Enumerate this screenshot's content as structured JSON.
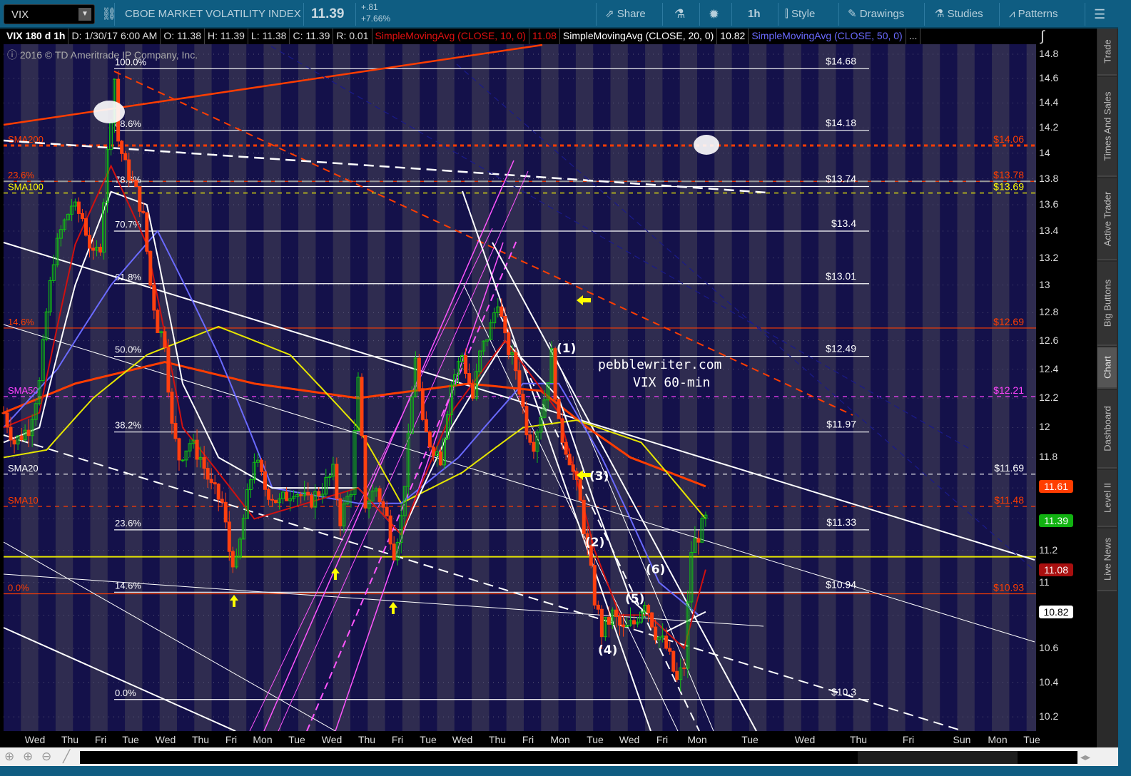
{
  "toolbar": {
    "symbol": "VIX",
    "description": "CBOE MARKET VOLATILITY INDEX",
    "last": "11.39",
    "change": "+.81",
    "change_pct": "+7.66%",
    "share": "Share",
    "timeframe": "1h",
    "style": "Style",
    "drawings": "Drawings",
    "studies": "Studies",
    "patterns": "Patterns"
  },
  "info": {
    "title": "VIX 180 d 1h",
    "date": "D: 1/30/17 6:00 AM",
    "open": "O: 11.38",
    "high": "H: 11.39",
    "low": "L: 11.38",
    "close": "C: 11.39",
    "range": "R: 0.01",
    "sma10": "SimpleMovingAvg (CLOSE, 10, 0)",
    "sma10_val": "11.08",
    "sma20": "SimpleMovingAvg (CLOSE, 20, 0)",
    "sma20_val": "10.82",
    "sma50": "SimpleMovingAvg (CLOSE, 50, 0)",
    "more": "..."
  },
  "copyright": "2016 © TD Ameritrade IP Company, Inc.",
  "watermark": "pebblewriter.com",
  "subtitle": "VIX 60-min",
  "sidebar": [
    "Trade",
    "Times And Sales",
    "Active Trader",
    "Big Buttons",
    "Chart",
    "Dashboard",
    "Level II",
    "Live News"
  ],
  "badges": [
    {
      "value": "11.61",
      "color": "#ff3d00"
    },
    {
      "value": "11.39",
      "color": "#11b211"
    },
    {
      "value": "11.08",
      "color": "#a80f0f"
    },
    {
      "value": "10.82",
      "color": "#ffffff"
    }
  ],
  "chart_data": {
    "type": "candlestick",
    "symbol": "VIX",
    "period": "180 d",
    "interval": "1h",
    "yticks": [
      14.8,
      14.6,
      14.4,
      14.2,
      14,
      13.8,
      13.6,
      13.4,
      13.2,
      13,
      12.8,
      12.6,
      12.4,
      12.2,
      12,
      11.8,
      11.6,
      11.4,
      11.2,
      11,
      10.8,
      10.6,
      10.4,
      10.2
    ],
    "ylim": [
      10.2,
      14.8
    ],
    "xticks": [
      "Wed",
      "Thu",
      "Fri",
      "Tue",
      "Wed",
      "Thu",
      "Fri",
      "Mon",
      "Tue",
      "Wed",
      "Thu",
      "Fri",
      "Tue",
      "Wed",
      "Thu",
      "Fri",
      "Mon",
      "Tue",
      "Wed",
      "Fri",
      "Mon",
      "Tue",
      "Wed",
      "Thu",
      "Fri",
      "Sun",
      "Mon",
      "Tue"
    ],
    "fib_levels": [
      {
        "pct": "100.0%",
        "price": 14.68,
        "label": "$14.68"
      },
      {
        "pct": "88.6%",
        "price": 14.18,
        "label": "$14.18"
      },
      {
        "pct": "78.6%",
        "price": 13.74,
        "label": "$13.74"
      },
      {
        "pct": "70.7%",
        "price": 13.4,
        "label": "$13.4"
      },
      {
        "pct": "61.8%",
        "price": 13.01,
        "label": "$13.01"
      },
      {
        "pct": "50.0%",
        "price": 12.49,
        "label": "$12.49"
      },
      {
        "pct": "38.2%",
        "price": 11.97,
        "label": "$11.97"
      },
      {
        "pct": "23.6%",
        "price": 11.33,
        "label": "$11.33"
      },
      {
        "pct": "14.6%",
        "price": 10.94,
        "label": "$10.94"
      },
      {
        "pct": "0.0%",
        "price": 10.3,
        "label": "$10.3"
      }
    ],
    "levels": [
      {
        "name": "SMA200",
        "price": 14.06,
        "label": "$14.06",
        "color": "#ff3d00",
        "style": "dotted"
      },
      {
        "name": "23.6%",
        "price": 13.78,
        "label": "$13.78",
        "color": "#ff3d00",
        "style": "solid"
      },
      {
        "name": "SMA100",
        "price": 13.69,
        "label": "$13.69",
        "color": "#ffff00",
        "style": "dashed"
      },
      {
        "name": "14.6%",
        "price": 12.69,
        "label": "$12.69",
        "color": "#ff3d00",
        "style": "solid"
      },
      {
        "name": "SMA50",
        "price": 12.21,
        "label": "$12.21",
        "color": "#ff44ff",
        "style": "dashed"
      },
      {
        "name": "SMA20",
        "price": 11.69,
        "label": "$11.69",
        "color": "#ffffff",
        "style": "dashed"
      },
      {
        "name": "SMA10",
        "price": 11.48,
        "label": "$11.48",
        "color": "#ff3d00",
        "style": "dashed"
      },
      {
        "name": "0.0%",
        "price": 10.93,
        "label": "$10.93",
        "color": "#ff3d00",
        "style": "solid"
      }
    ],
    "waves": [
      "(1)",
      "(2)",
      "(3)",
      "(4)",
      "(5)",
      "(6)"
    ],
    "close_path": [
      [
        0,
        12.1
      ],
      [
        3,
        11.9
      ],
      [
        7,
        12.0
      ],
      [
        10,
        12.3
      ],
      [
        12,
        12.8
      ],
      [
        14,
        13.2
      ],
      [
        16,
        13.4
      ],
      [
        19,
        13.6
      ],
      [
        22,
        13.5
      ],
      [
        25,
        13.2
      ],
      [
        27,
        13.3
      ],
      [
        29,
        14.0
      ],
      [
        31,
        14.6
      ],
      [
        32,
        14.1
      ],
      [
        34,
        13.9
      ],
      [
        37,
        13.7
      ],
      [
        39,
        13.5
      ],
      [
        41,
        13.0
      ],
      [
        43,
        12.7
      ],
      [
        45,
        12.6
      ],
      [
        47,
        12.0
      ],
      [
        49,
        11.8
      ],
      [
        52,
        11.9
      ],
      [
        55,
        11.8
      ],
      [
        58,
        11.6
      ],
      [
        61,
        11.5
      ],
      [
        63,
        11.2
      ],
      [
        65,
        11.1
      ],
      [
        67,
        11.4
      ],
      [
        70,
        11.8
      ],
      [
        73,
        11.6
      ],
      [
        77,
        11.5
      ],
      [
        81,
        11.6
      ],
      [
        85,
        11.5
      ],
      [
        89,
        11.6
      ],
      [
        92,
        11.7
      ],
      [
        94,
        11.4
      ],
      [
        97,
        11.6
      ],
      [
        99,
        12.3
      ],
      [
        101,
        11.5
      ],
      [
        104,
        11.6
      ],
      [
        107,
        11.4
      ],
      [
        109,
        11.2
      ],
      [
        111,
        11.4
      ],
      [
        113,
        11.9
      ],
      [
        115,
        12.5
      ],
      [
        117,
        12.0
      ],
      [
        119,
        11.9
      ],
      [
        122,
        11.8
      ],
      [
        125,
        12.3
      ],
      [
        128,
        12.5
      ],
      [
        131,
        12.2
      ],
      [
        133,
        12.5
      ],
      [
        136,
        12.7
      ],
      [
        138,
        12.9
      ],
      [
        140,
        12.6
      ],
      [
        143,
        12.4
      ],
      [
        146,
        12.0
      ],
      [
        148,
        11.9
      ],
      [
        151,
        12.2
      ],
      [
        153,
        12.5
      ],
      [
        155,
        12.0
      ],
      [
        158,
        11.8
      ],
      [
        161,
        11.5
      ],
      [
        163,
        11.2
      ],
      [
        165,
        10.9
      ],
      [
        167,
        10.7
      ],
      [
        170,
        10.8
      ],
      [
        173,
        10.7
      ],
      [
        176,
        10.75
      ],
      [
        179,
        10.9
      ],
      [
        182,
        10.7
      ],
      [
        185,
        10.6
      ],
      [
        188,
        10.4
      ],
      [
        190,
        10.5
      ],
      [
        192,
        11.2
      ],
      [
        194,
        11.3
      ],
      [
        196,
        11.39
      ]
    ],
    "series": [
      {
        "name": "SMA 200h",
        "color": "#ff3d00",
        "points": [
          [
            0,
            12.1
          ],
          [
            20,
            12.3
          ],
          [
            45,
            12.45
          ],
          [
            70,
            12.3
          ],
          [
            99,
            12.2
          ],
          [
            130,
            12.3
          ],
          [
            150,
            12.25
          ],
          [
            163,
            12.0
          ],
          [
            175,
            11.8
          ],
          [
            196,
            11.61
          ]
        ]
      },
      {
        "name": "SMA 100h",
        "color": "#e6e600",
        "points": [
          [
            0,
            11.8
          ],
          [
            12,
            11.85
          ],
          [
            25,
            12.2
          ],
          [
            40,
            12.5
          ],
          [
            60,
            12.7
          ],
          [
            80,
            12.5
          ],
          [
            99,
            12.0
          ],
          [
            111,
            11.5
          ],
          [
            128,
            11.7
          ],
          [
            145,
            12.0
          ],
          [
            160,
            12.05
          ],
          [
            178,
            11.9
          ],
          [
            196,
            11.4
          ]
        ]
      },
      {
        "name": "SMA 50",
        "color": "#6a6aff",
        "points": [
          [
            0,
            12.0
          ],
          [
            15,
            12.4
          ],
          [
            30,
            13.0
          ],
          [
            43,
            13.4
          ],
          [
            60,
            12.5
          ],
          [
            75,
            11.6
          ],
          [
            99,
            11.5
          ],
          [
            111,
            11.5
          ],
          [
            127,
            11.8
          ],
          [
            145,
            12.3
          ],
          [
            155,
            12.3
          ],
          [
            167,
            11.8
          ],
          [
            183,
            11.0
          ],
          [
            194,
            10.8
          ]
        ]
      },
      {
        "name": "SMA 20",
        "color": "#ffffff",
        "points": [
          [
            0,
            11.9
          ],
          [
            10,
            12.0
          ],
          [
            20,
            13.0
          ],
          [
            30,
            13.7
          ],
          [
            40,
            13.6
          ],
          [
            50,
            12.3
          ],
          [
            60,
            11.8
          ],
          [
            75,
            11.6
          ],
          [
            99,
            11.6
          ],
          [
            111,
            11.3
          ],
          [
            125,
            12.0
          ],
          [
            140,
            12.6
          ],
          [
            155,
            12.2
          ],
          [
            165,
            11.5
          ],
          [
            175,
            10.9
          ],
          [
            185,
            10.7
          ],
          [
            196,
            10.82
          ]
        ]
      },
      {
        "name": "SMA 10",
        "color": "#d01010",
        "points": [
          [
            0,
            12.0
          ],
          [
            10,
            12.1
          ],
          [
            20,
            13.3
          ],
          [
            30,
            13.9
          ],
          [
            40,
            13.3
          ],
          [
            50,
            12.0
          ],
          [
            60,
            11.7
          ],
          [
            70,
            11.4
          ],
          [
            99,
            11.6
          ],
          [
            111,
            11.3
          ],
          [
            125,
            12.1
          ],
          [
            140,
            12.6
          ],
          [
            155,
            12.1
          ],
          [
            165,
            11.2
          ],
          [
            172,
            10.8
          ],
          [
            180,
            10.8
          ],
          [
            190,
            10.6
          ],
          [
            196,
            11.08
          ]
        ]
      }
    ]
  }
}
